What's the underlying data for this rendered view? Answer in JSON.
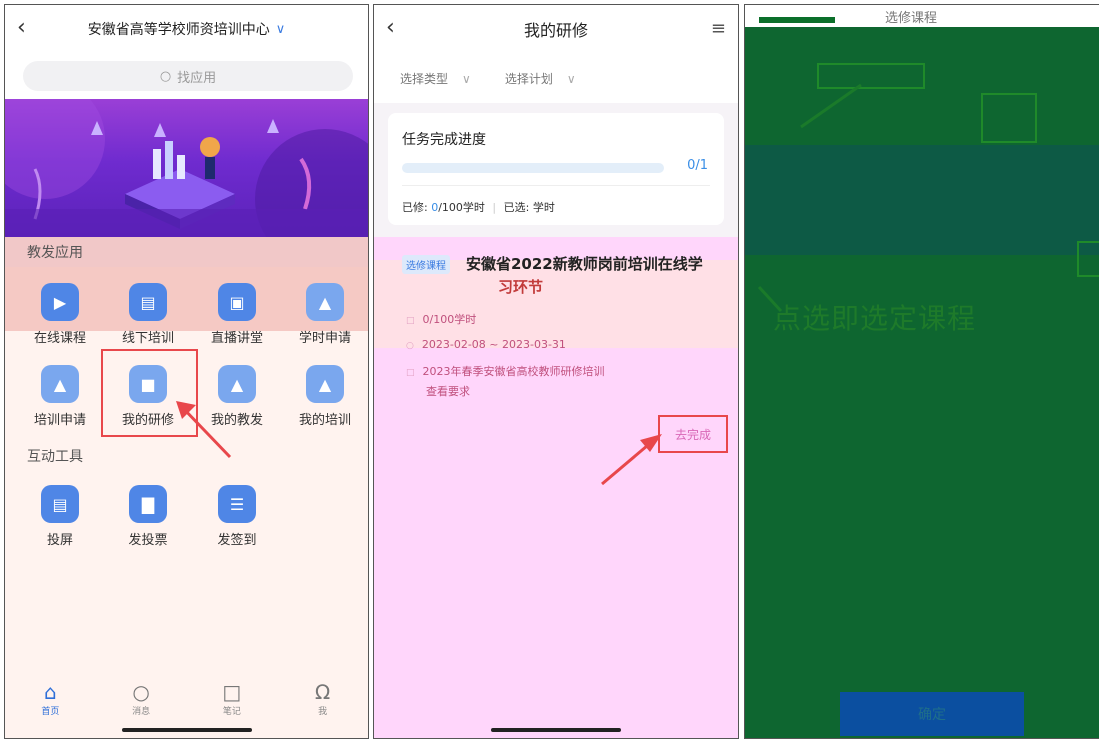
{
  "panel1": {
    "title": "安徽省高等学校师资培训中心",
    "search_placeholder": "找应用",
    "section_jiaofa": "教发应用",
    "apps_row1": [
      "在线课程",
      "线下培训",
      "直播讲堂",
      "学时申请"
    ],
    "apps_row2": [
      "培训申请",
      "我的研修",
      "我的教发",
      "我的培训"
    ],
    "section_hudong": "互动工具",
    "tools": [
      "投屏",
      "发投票",
      "发签到"
    ],
    "tabs": [
      "首页",
      "消息",
      "笔记",
      "我"
    ],
    "icons": [
      "back-icon",
      "chevron-down-icon",
      "search-icon",
      "home-icon",
      "chat-icon",
      "edit-icon",
      "user-icon"
    ]
  },
  "panel2": {
    "title": "我的研修",
    "filter_type": "选择类型",
    "filter_plan": "选择计划",
    "progress_title": "任务完成进度",
    "progress_text": "0/1",
    "progress_fraction": 0,
    "stats_done_label": "已修:",
    "stats_done_value": "0",
    "stats_done_rest": "/100学时",
    "stats_selected": "已选: 学时",
    "course_tag": "选修课程",
    "course_title_line1": "安徽省2022新教师岗前培训在线学",
    "course_title_line2": "习环节",
    "hours": "0/100学时",
    "date_range": "2023-02-08 ~ 2023-03-31",
    "program": "2023年春季安徽省高校教师研修培训",
    "view_requirements": "查看要求",
    "complete_button": "去完成"
  },
  "panel3": {
    "title": "选修课程",
    "hint": "点选即选定课程",
    "confirm": "确定"
  },
  "colors": {
    "accent_blue": "#3a8ee6",
    "annotation_red": "#e8474b",
    "banner_purple": "#6f2bcf"
  }
}
